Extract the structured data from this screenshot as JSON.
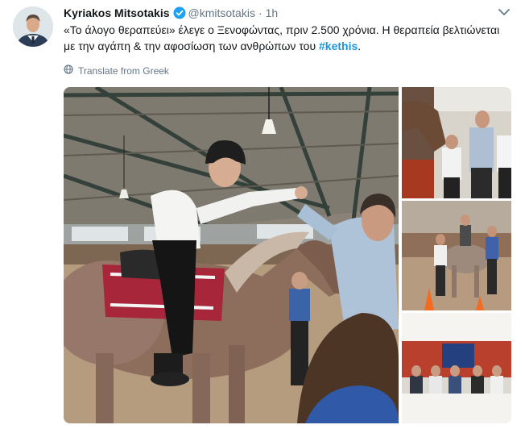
{
  "tweet": {
    "author_name": "Kyriakos Mitsotakis",
    "handle": "@kmitsotakis",
    "separator": "·",
    "time": "1h",
    "text_main": "«Το άλογο θεραπεύει» έλεγε ο Ξενοφώντας, πριν 2.500 χρόνια. Η θεραπεία βελτιώνεται με την αγάπη & την αφοσίωση των ανθρώπων του ",
    "hashtag": "#kethis",
    "text_end": ".",
    "translate_label": "Translate from Greek"
  },
  "icons": {
    "verified": "verified-badge-icon",
    "caret": "chevron-down-icon",
    "globe": "globe-icon"
  },
  "colors": {
    "link": "#1b95e0",
    "secondary_text": "#657786",
    "verified": "#1da1f2"
  }
}
